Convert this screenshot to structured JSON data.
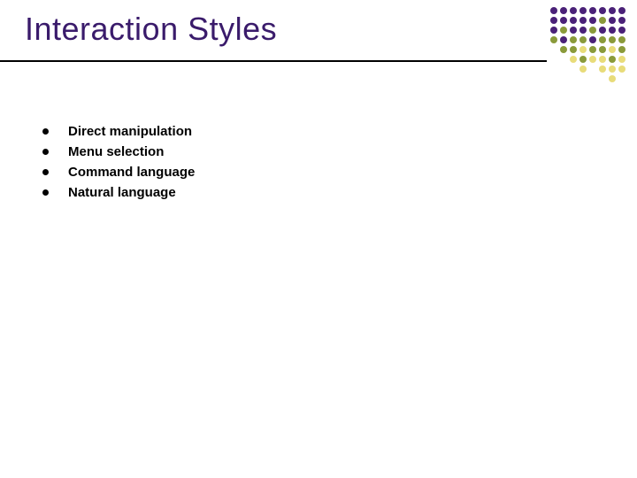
{
  "slide": {
    "title": "Interaction Styles",
    "bullets": [
      "Direct manipulation",
      "Menu selection",
      "Command language",
      "Natural language"
    ]
  }
}
